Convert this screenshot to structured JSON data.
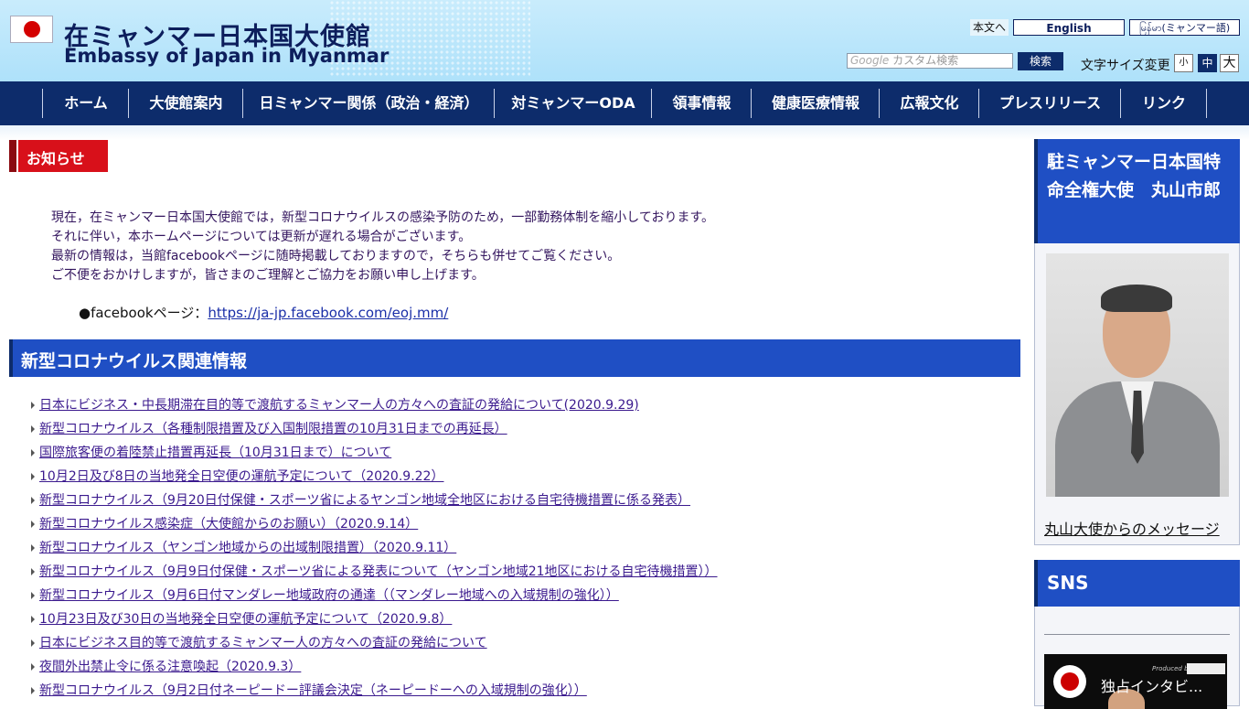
{
  "header": {
    "title_jp": "在ミャンマー日本国大使館",
    "title_en": "Embassy of Japan in Myanmar",
    "skip_label": "本文へ",
    "lang_en": "English",
    "lang_my": "မြန်မာ(ミャンマー語)",
    "search_brand": "Google",
    "search_placeholder": "カスタム検索",
    "search_button": "検索",
    "fontsize_label": "文字サイズ変更",
    "fontsize_small": "小",
    "fontsize_mid": "中",
    "fontsize_big": "大"
  },
  "nav": [
    {
      "label": "ホーム"
    },
    {
      "label": "大使館案内"
    },
    {
      "label": "日ミャンマー関係（政治・経済）"
    },
    {
      "label": "対ミャンマーODA"
    },
    {
      "label": "領事情報"
    },
    {
      "label": "健康医療情報"
    },
    {
      "label": "広報文化"
    },
    {
      "label": "プレスリリース"
    },
    {
      "label": "リンク"
    }
  ],
  "notice": {
    "heading": "お知らせ",
    "lines": [
      "現在，在ミャンマー日本国大使館では，新型コロナウイルスの感染予防のため，一部勤務体制を縮小しております。",
      "それに伴い，本ホームページについては更新が遅れる場合がございます。",
      "最新の情報は，当館facebookページに随時掲載しておりますので，そちらも併せてご覧ください。",
      "ご不便をおかけしますが，皆さまのご理解とご協力をお願い申し上げます。"
    ],
    "fb_prefix": "●facebookページ：",
    "fb_link": "https://ja-jp.facebook.com/eoj.mm/"
  },
  "covid": {
    "heading": "新型コロナウイルス関連情報",
    "items": [
      "日本にビジネス・中長期滞在目的等で渡航するミャンマー人の方々への査証の発給について(2020.9.29)",
      "新型コロナウイルス（各種制限措置及び入国制限措置の10月31日までの再延長）",
      "国際旅客便の着陸禁止措置再延長（10月31日まで）について",
      "10月2日及び8日の当地発全日空便の運航予定について（2020.9.22）",
      "新型コロナウイルス（9月20日付保健・スポーツ省によるヤンゴン地域全地区における自宅待機措置に係る発表）",
      "新型コロナウイルス感染症（大使館からのお願い）（2020.9.14）",
      "新型コロナウイルス（ヤンゴン地域からの出域制限措置）（2020.9.11）",
      "新型コロナウイルス（9月9日付保健・スポーツ省による発表について（ヤンゴン地域21地区における自宅待機措置））",
      "新型コロナウイルス（9月6日付マンダレー地域政府の通達（（マンダレー地域への入域規制の強化））",
      "10月23日及び30日の当地発全日空便の運航予定について（2020.9.8）",
      "日本にビジネス目的等で渡航するミャンマー人の方々への査証の発給について",
      "夜間外出禁止令に係る注意喚起（2020.9.3）",
      "新型コロナウイルス（9月2日付ネーピードー評議会決定（ネーピードーへの入域規制の強化））"
    ]
  },
  "sidebar": {
    "ambassador_heading": "駐ミャンマー日本国特命全権大使　丸山市郎",
    "ambassador_link": "丸山大使からのメッセージ",
    "sns_heading": "SNS",
    "video_title": "独占インタビ...",
    "video_producer": "Produced by"
  }
}
